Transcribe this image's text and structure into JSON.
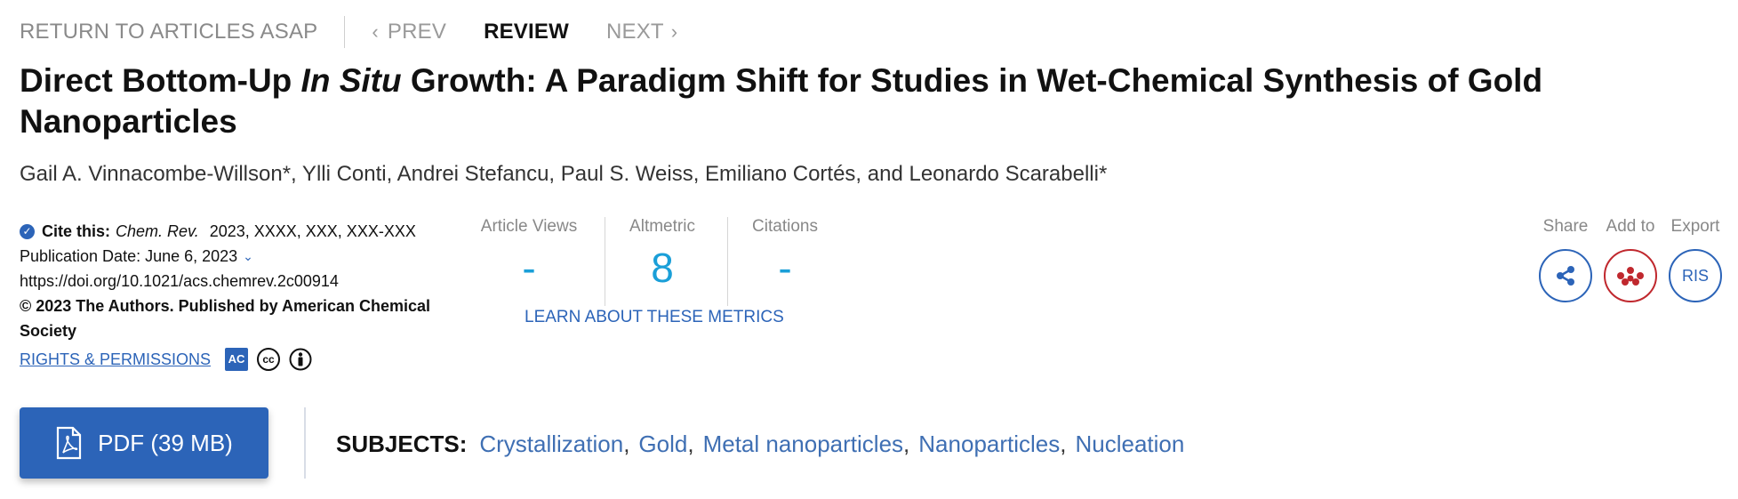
{
  "nav": {
    "back": "RETURN TO ARTICLES ASAP",
    "prev": "PREV",
    "review": "REVIEW",
    "next": "NEXT"
  },
  "article": {
    "title_part1": "Direct Bottom-Up ",
    "title_italic": "In Situ",
    "title_part2": " Growth: A Paradigm Shift for Studies in Wet-Chemical Synthesis of Gold Nanoparticles",
    "authors": "Gail A. Vinnacombe-Willson*, Ylli Conti, Andrei Stefancu, Paul S. Weiss, Emiliano Cortés, and Leonardo Scarabelli*"
  },
  "cite": {
    "label": "Cite this:",
    "journal": "Chem. Rev.",
    "ref": "2023, XXXX, XXX, XXX-XXX",
    "pub_date": "Publication Date: June 6, 2023",
    "doi": "https://doi.org/10.1021/acs.chemrev.2c00914",
    "copyright": "© 2023 The Authors. Published by American Chemical Society",
    "rights": "RIGHTS & PERMISSIONS",
    "ac_badge": "AC"
  },
  "metrics": {
    "views_label": "Article Views",
    "views_value": "-",
    "altmetric_label": "Altmetric",
    "altmetric_value": "8",
    "citations_label": "Citations",
    "citations_value": "-",
    "learn": "LEARN ABOUT THESE METRICS"
  },
  "tools": {
    "share_label": "Share",
    "add_label": "Add to",
    "export_label": "Export",
    "ris": "RIS"
  },
  "pdf": {
    "label": "PDF (39 MB)"
  },
  "subjects": {
    "label": "SUBJECTS:",
    "items": [
      "Crystallization",
      "Gold",
      "Metal nanoparticles",
      "Nanoparticles",
      "Nucleation"
    ]
  },
  "colors": {
    "accent": "#2c64b8",
    "metric": "#1a9fd8",
    "mendeley": "#c0282e"
  },
  "icons": [
    "check-icon",
    "chevron-left-icon",
    "chevron-right-icon",
    "chevron-down-icon",
    "creative-commons-icon",
    "attribution-icon",
    "share-icon",
    "mendeley-icon",
    "pdf-file-icon"
  ]
}
